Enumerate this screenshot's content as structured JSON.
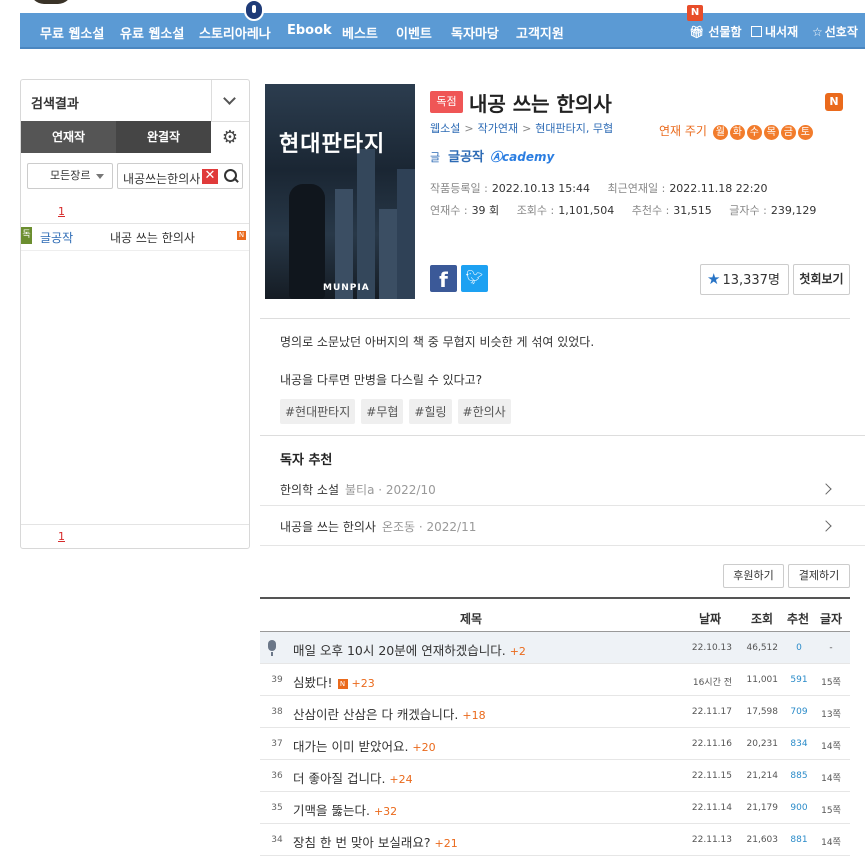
{
  "nav": {
    "items": [
      "무료 웹소설",
      "유료 웹소설",
      "스토리아레나",
      "Ebook",
      "베스트",
      "이벤트",
      "독자마당",
      "고객지원"
    ],
    "new_badge": "N",
    "right": {
      "gift": "선물함",
      "library": "내서재",
      "favorites": "선호작"
    }
  },
  "sidebar": {
    "title": "검색결과",
    "tabs": [
      "연재작",
      "완결작"
    ],
    "genre_select": "모든장르",
    "search_value": "내공쓰는한의사",
    "clear_label": "✕",
    "page_top": "1",
    "page_bottom": "1",
    "results": [
      {
        "badge": "독",
        "author": "글공작",
        "title": "내공 쓰는 한의사",
        "new": "N"
      }
    ]
  },
  "book": {
    "cover_title": "현대판타지",
    "cover_logo": "MUNPIA",
    "exclusive_tag": "독점",
    "title": "내공 쓰는 한의사",
    "new_badge": "N",
    "crumbs": [
      "웹소설",
      "작가연재",
      "현대판타지, 무협"
    ],
    "cycle_label": "연재 주기",
    "days": [
      "월",
      "화",
      "수",
      "목",
      "금",
      "토"
    ],
    "author_label": "글",
    "author": "글공작",
    "academy": "cademy",
    "meta": {
      "registered_label": "작품등록일 :",
      "registered": "2022.10.13 15:44",
      "updated_label": "최근연재일 :",
      "updated": "2022.11.18 22:20",
      "episodes_label": "연재수 :",
      "episodes": "39 회",
      "views_label": "조회수 :",
      "views": "1,101,504",
      "recommend_label": "추천수 :",
      "recommend": "31,515",
      "chars_label": "글자수 :",
      "chars": "239,129"
    },
    "facebook": "f",
    "favorites_count": "13,337명",
    "first_view": "첫회보기"
  },
  "synopsis": {
    "line1": "명의로 소문났던 아버지의 책 중 무협지 비슷한 게 섞여 있었다.",
    "line2": "내공을 다루면 만병을 다스릴 수 있다고?",
    "tags": [
      "#현대판타지",
      "#무협",
      "#힐링",
      "#한의사"
    ]
  },
  "recommend": {
    "heading": "독자 추천",
    "items": [
      {
        "title": "한의학 소설",
        "by": "불티a · 2022/10"
      },
      {
        "title": "내공을 쓰는 한의사",
        "by": "온조동 · 2022/11"
      }
    ]
  },
  "actions": {
    "support": "후원하기",
    "pay": "결제하기"
  },
  "table": {
    "headers": {
      "title": "제목",
      "date": "날짜",
      "views": "조회",
      "rec": "추천",
      "words": "글자"
    },
    "notice": {
      "title": "매일 오후 10시 20분에 연재하겠습니다.",
      "plus": "+2",
      "date": "22.10.13",
      "views": "46,512",
      "rec": "0",
      "words": "-"
    },
    "rows": [
      {
        "no": "39",
        "title": "심봤다!",
        "new": "N",
        "plus": "+23",
        "date": "16시간 전",
        "views": "11,001",
        "rec": "591",
        "words": "15쪽"
      },
      {
        "no": "38",
        "title": "산삼이란 산삼은 다 캐겠습니다.",
        "plus": "+18",
        "date": "22.11.17",
        "views": "17,598",
        "rec": "709",
        "words": "13쪽"
      },
      {
        "no": "37",
        "title": "대가는 이미 받았어요.",
        "plus": "+20",
        "date": "22.11.16",
        "views": "20,231",
        "rec": "834",
        "words": "14쪽"
      },
      {
        "no": "36",
        "title": "더 좋아질 겁니다.",
        "plus": "+24",
        "date": "22.11.15",
        "views": "21,214",
        "rec": "885",
        "words": "14쪽"
      },
      {
        "no": "35",
        "title": "기맥을 뚫는다.",
        "plus": "+32",
        "date": "22.11.14",
        "views": "21,179",
        "rec": "900",
        "words": "15쪽"
      },
      {
        "no": "34",
        "title": "장침 한 번 맞아 보실래요?",
        "plus": "+21",
        "date": "22.11.13",
        "views": "21,603",
        "rec": "881",
        "words": "14쪽"
      }
    ]
  }
}
